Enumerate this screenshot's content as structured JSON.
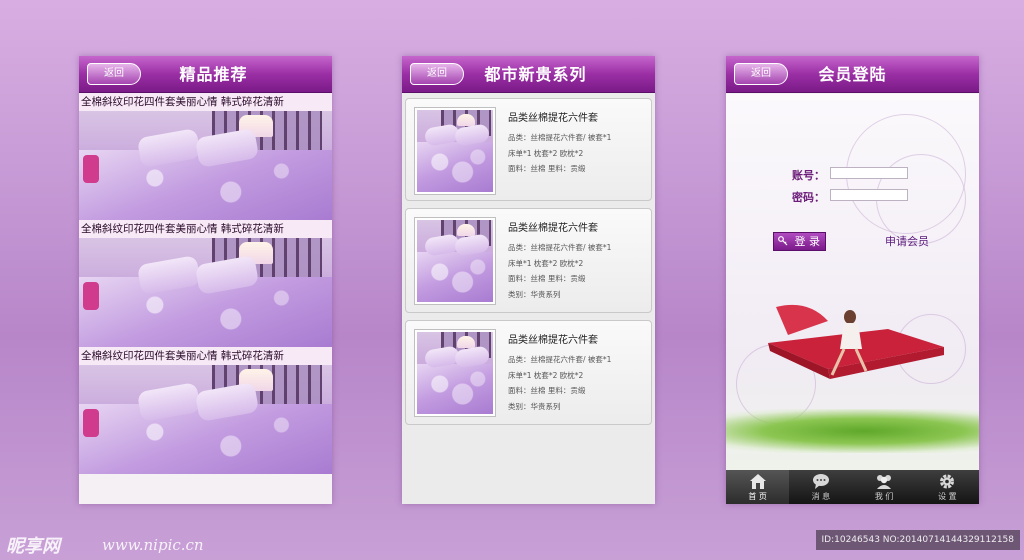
{
  "screens": [
    {
      "back_label": "返回",
      "title": "精品推荐",
      "items": [
        {
          "caption": "全棉斜纹印花四件套美丽心情  韩式碎花清新"
        },
        {
          "caption": "全棉斜纹印花四件套美丽心情  韩式碎花清新"
        },
        {
          "caption": "全棉斜纹印花四件套美丽心情  韩式碎花清新"
        }
      ]
    },
    {
      "back_label": "返回",
      "title": "都市新贵系列",
      "products": [
        {
          "title": "品类丝棉提花六件套",
          "lines": [
            "品类：丝棉提花六件套/ 被套*1",
            "床单*1  枕套*2  欧枕*2",
            "面料：丝棉  里料：贡缎"
          ]
        },
        {
          "title": "品类丝棉提花六件套",
          "lines": [
            "品类：丝棉提花六件套/ 被套*1",
            "床单*1  枕套*2  欧枕*2",
            "面料：丝棉  里料：贡缎",
            "类别：华贵系列"
          ]
        },
        {
          "title": "品类丝棉提花六件套",
          "lines": [
            "品类：丝棉提花六件套/ 被套*1",
            "床单*1  枕套*2  欧枕*2",
            "面料：丝棉  里料：贡缎",
            "类别：华贵系列"
          ]
        }
      ]
    },
    {
      "back_label": "返回",
      "title": "会员登陆",
      "account_label": "账号：",
      "password_label": "密码：",
      "account_value": "",
      "password_value": "",
      "login_label": "登 录",
      "apply_label": "申请会员",
      "tabs": [
        {
          "label": "首 页",
          "icon": "home-icon",
          "active": true
        },
        {
          "label": "消 息",
          "icon": "chat-bubble-icon",
          "active": false
        },
        {
          "label": "我 们",
          "icon": "people-icon",
          "active": false
        },
        {
          "label": "设 置",
          "icon": "gear-icon",
          "active": false
        }
      ]
    }
  ],
  "watermark": {
    "logo": "昵享网",
    "url": "www.nipic.cn",
    "id_text": "ID:10246543 NO:20140714144329112158"
  },
  "colors": {
    "header_purple": "#9b2fa5",
    "background_lilac": "#c79bd6",
    "login_label_color": "#6d1d7a"
  }
}
